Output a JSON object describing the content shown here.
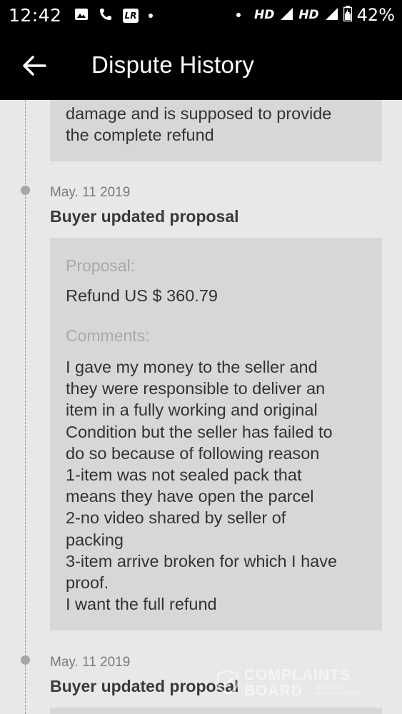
{
  "status_bar": {
    "time": "12:42",
    "network_1": "HD",
    "network_2": "HD",
    "battery": "42%",
    "icons": [
      "image-icon",
      "phone-icon",
      "lr-app-icon",
      "dot-icon",
      "dot-icon",
      "signal-icon",
      "signal-icon",
      "battery-icon"
    ],
    "lr_label": "LR"
  },
  "app_bar": {
    "title": "Dispute History",
    "back_icon": "arrow-left-icon"
  },
  "timeline": {
    "previous_card_text": "damage and is supposed to provide\nthe complete refund",
    "entries": [
      {
        "date": "May. 11 2019",
        "title": "Buyer updated proposal",
        "proposal_label": "Proposal:",
        "proposal_value": "Refund US $ 360.79",
        "comments_label": "Comments:",
        "comments_value": "I gave my money to the seller and\nthey were responsible to deliver an\nitem in a  fully working and original\nCondition but the seller has failed to\ndo so because of following reason\n1-item was not sealed pack that\nmeans they have open the parcel\n2-no video shared by seller of\npacking\n3-item arrive broken for which I have\nproof.\nI want the full refund"
      },
      {
        "date": "May. 11 2019",
        "title": "Buyer updated proposal"
      }
    ]
  },
  "watermark": {
    "line1": "COMPLAINTS",
    "line2": "BOARD",
    "tagline": "RESOLVING BUSINESS ISSUES"
  },
  "colors": {
    "status_bar_bg": "#000000",
    "app_bar_bg": "#000000",
    "page_bg": "#e8e8e8",
    "card_bg": "#d7d7d7",
    "label_color": "#a9a9a9"
  }
}
